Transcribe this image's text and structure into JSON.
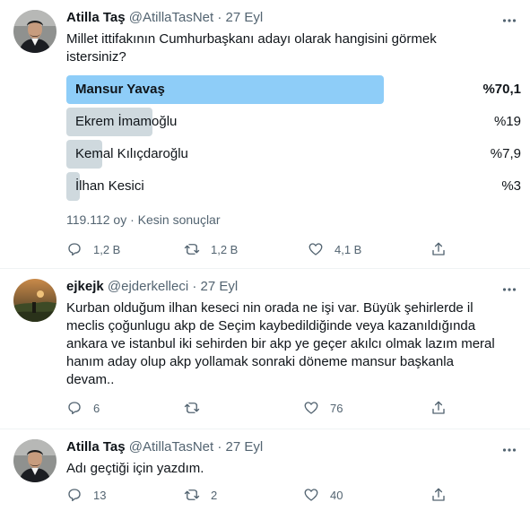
{
  "tweets": [
    {
      "name": "Atilla Taş",
      "handle": "@AtillaTasNet",
      "dot": "·",
      "date": "27 Eyl",
      "text_lines": [
        "Millet ittifakının Cumhurbaşkanı adayı olarak hangisini görmek",
        "istersiniz?"
      ],
      "poll": {
        "options": [
          {
            "label": "Mansur Yavaş",
            "percent": "%70,1",
            "share": 0.701,
            "winner": true
          },
          {
            "label": "Ekrem İmamoğlu",
            "percent": "%19",
            "share": 0.19,
            "winner": false
          },
          {
            "label": "Kemal Kılıçdaroğlu",
            "percent": "%7,9",
            "share": 0.079,
            "winner": false
          },
          {
            "label": "İlhan Kesici",
            "percent": "%3",
            "share": 0.03,
            "winner": false
          }
        ],
        "votes": "119.112 oy",
        "sep": "·",
        "status": "Kesin sonuçlar"
      },
      "actions": {
        "reply": "1,2 B",
        "retweet": "1,2 B",
        "like": "4,1 B"
      }
    },
    {
      "name": "ejkejk",
      "handle": "@ejderkelleci",
      "dot": "·",
      "date": "27 Eyl",
      "text_lines": [
        "Kurban olduğum ilhan keseci nin orada ne işi var. Büyük şehirlerde il",
        "meclis çoğunlugu akp de Seçim kaybedildiğinde veya kazanıldığında",
        "ankara ve istanbul iki sehirden bir akp ye geçer akılcı olmak lazım meral",
        "hanım aday olup akp yollamak sonraki döneme mansur başkanla",
        "devam.."
      ],
      "actions": {
        "reply": "6",
        "retweet": "",
        "like": "76"
      }
    },
    {
      "name": "Atilla Taş",
      "handle": "@AtillaTasNet",
      "dot": "·",
      "date": "27 Eyl",
      "text_lines": [
        "Adı geçtiği için yazdım."
      ],
      "actions": {
        "reply": "13",
        "retweet": "2",
        "like": "40"
      }
    }
  ],
  "icons": {
    "more": "more-icon",
    "reply": "reply-icon",
    "retweet": "retweet-icon",
    "like": "like-icon",
    "share": "share-icon"
  },
  "colors": {
    "poll_winner": "#8ecdf8",
    "poll_other": "#cfd9de",
    "secondary_text": "#536471"
  }
}
